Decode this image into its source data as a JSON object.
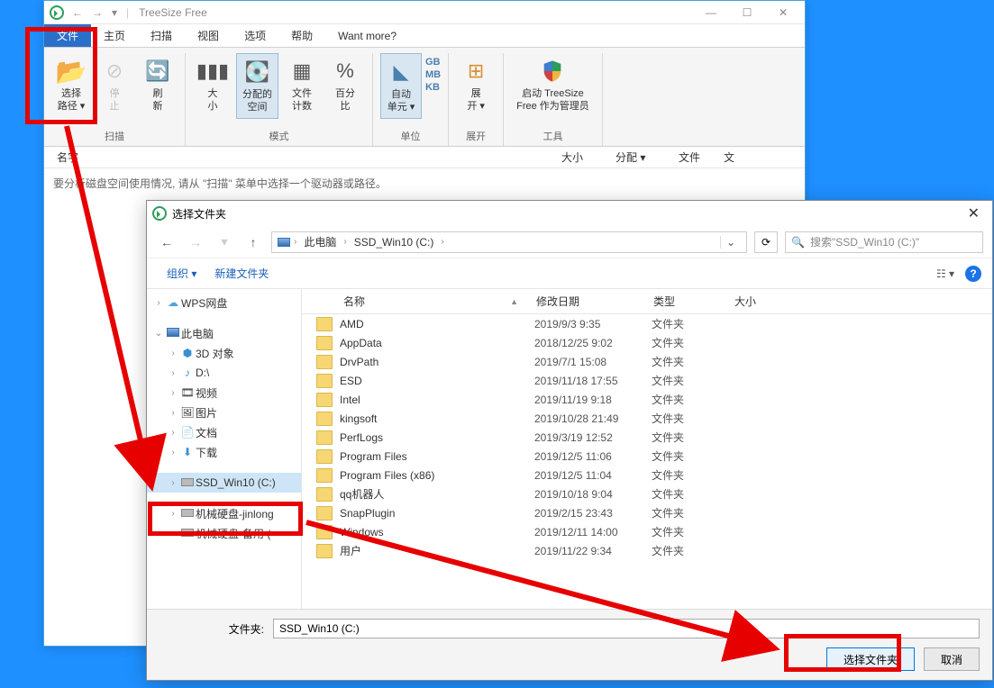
{
  "app": {
    "title": "TreeSize Free"
  },
  "win_controls": {
    "min": "—",
    "max": "☐",
    "close": "✕"
  },
  "tabs": {
    "file": "文件",
    "home": "主页",
    "scan": "扫描",
    "view": "视图",
    "options": "选项",
    "help": "帮助",
    "want_more": "Want more?"
  },
  "ribbon": {
    "select_path": "选择\n路径 ▾",
    "stop": "停\n止",
    "refresh": "刷\n新",
    "scan_label": "扫描",
    "size": "大\n小",
    "allocated": "分配的\n空间",
    "file_count": "文件\n计数",
    "percent": "百分\n比",
    "mode_label": "模式",
    "auto_unit": "自动\n单元 ▾",
    "gb": "GB",
    "mb": "MB",
    "kb": "KB",
    "unit_label": "单位",
    "expand": "展\n开 ▾",
    "expand_label": "展开",
    "launch_admin": "启动 TreeSize\nFree 作为管理员",
    "tools_label": "工具"
  },
  "columns": {
    "name": "名字",
    "size": "大小",
    "alloc": "分配 ▾",
    "files": "文件",
    "folders": "文"
  },
  "hint": "要分析磁盘空间使用情况, 请从 \"扫描\" 菜单中选择一个驱动器或路径。",
  "dialog": {
    "title": "选择文件夹",
    "breadcrumb": {
      "pc": "此电脑",
      "drive": "SSD_Win10 (C:)"
    },
    "search_placeholder": "搜索\"SSD_Win10 (C:)\"",
    "organize": "组织 ▾",
    "new_folder": "新建文件夹",
    "tree": {
      "wps": "WPS网盘",
      "this_pc": "此电脑",
      "obj3d": "3D 对象",
      "d_drive": "D:\\",
      "videos": "视频",
      "pictures": "图片",
      "documents": "文档",
      "downloads": "下载",
      "ssd": "SSD_Win10 (C:)",
      "hdd1": "机械硬盘-jinlong",
      "hdd2": "机械硬盘-备用 ("
    },
    "cols": {
      "name": "名称",
      "date": "修改日期",
      "type": "类型",
      "size": "大小"
    },
    "rows": [
      {
        "name": "AMD",
        "date": "2019/9/3 9:35",
        "type": "文件夹"
      },
      {
        "name": "AppData",
        "date": "2018/12/25 9:02",
        "type": "文件夹"
      },
      {
        "name": "DrvPath",
        "date": "2019/7/1 15:08",
        "type": "文件夹"
      },
      {
        "name": "ESD",
        "date": "2019/11/18 17:55",
        "type": "文件夹"
      },
      {
        "name": "Intel",
        "date": "2019/11/19 9:18",
        "type": "文件夹"
      },
      {
        "name": "kingsoft",
        "date": "2019/10/28 21:49",
        "type": "文件夹"
      },
      {
        "name": "PerfLogs",
        "date": "2019/3/19 12:52",
        "type": "文件夹"
      },
      {
        "name": "Program Files",
        "date": "2019/12/5 11:06",
        "type": "文件夹"
      },
      {
        "name": "Program Files (x86)",
        "date": "2019/12/5 11:04",
        "type": "文件夹"
      },
      {
        "name": "qq机器人",
        "date": "2019/10/18 9:04",
        "type": "文件夹"
      },
      {
        "name": "SnapPlugin",
        "date": "2019/2/15 23:43",
        "type": "文件夹"
      },
      {
        "name": "Windows",
        "date": "2019/12/11 14:00",
        "type": "文件夹"
      },
      {
        "name": "用户",
        "date": "2019/11/22 9:34",
        "type": "文件夹"
      }
    ],
    "folder_label": "文件夹:",
    "folder_value": "SSD_Win10 (C:)",
    "select_btn": "选择文件夹",
    "cancel_btn": "取消"
  }
}
